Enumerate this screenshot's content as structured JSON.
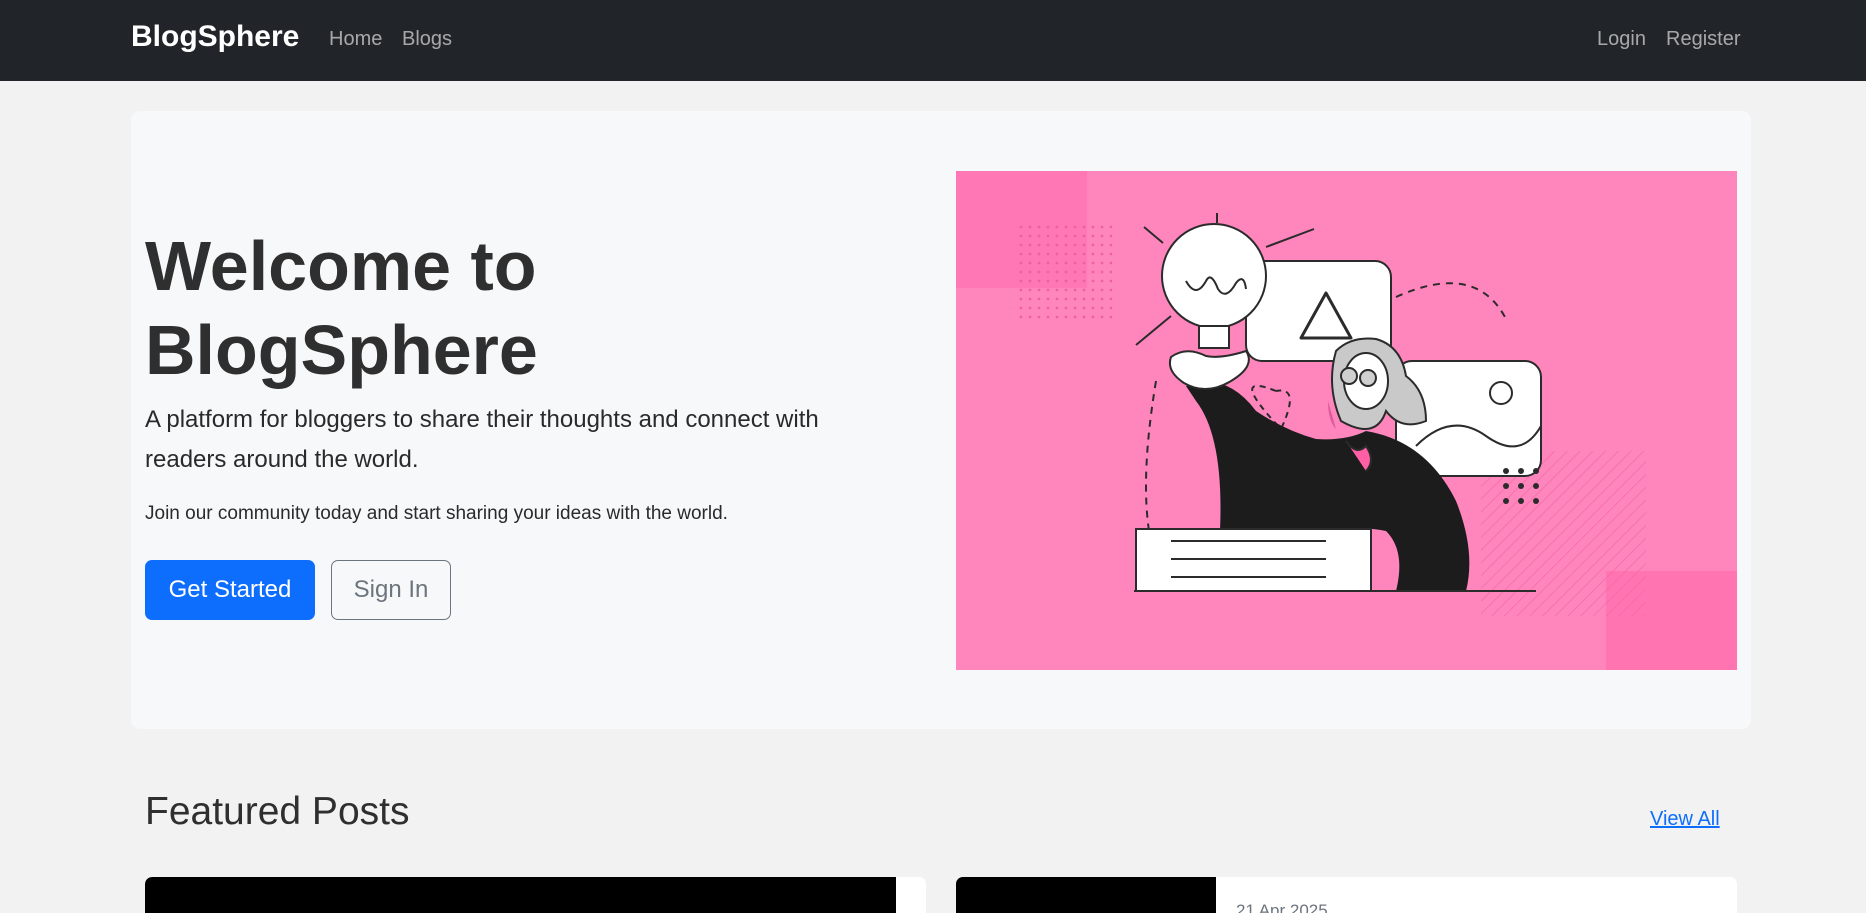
{
  "nav": {
    "brand": "BlogSphere",
    "links": [
      "Home",
      "Blogs"
    ],
    "auth": [
      "Login",
      "Register"
    ]
  },
  "hero": {
    "title_line1": "Welcome to",
    "title_line2": "BlogSphere",
    "lead": "A platform for bloggers to share their thoughts and connect with readers around the world.",
    "sub": "Join our community today and start sharing your ideas with the world.",
    "primary_button": "Get Started",
    "secondary_button": "Sign In",
    "illustration_bg": "#ff86bd"
  },
  "featured": {
    "title": "Featured Posts",
    "view_all": "View All",
    "posts": [
      {
        "date": ""
      },
      {
        "date": "21 Apr 2025"
      }
    ]
  },
  "colors": {
    "navbar": "#212529",
    "primary": "#0d6efd",
    "secondary": "#6c757d",
    "page_bg": "#f2f2f2"
  }
}
